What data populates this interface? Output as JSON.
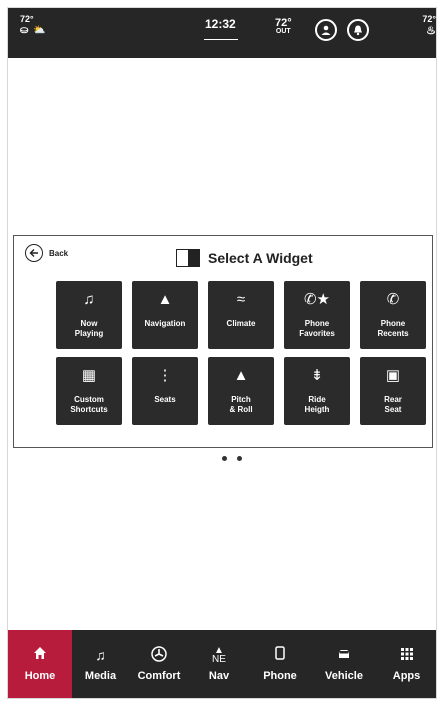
{
  "status_bar": {
    "left_temp": "72°",
    "left_icons": "⛀ ⛅",
    "time": "12:32",
    "outside_temp": "72°",
    "outside_label": "OUT",
    "right_temp": "72°",
    "right_icon": "♨"
  },
  "panel": {
    "back_label": "Back",
    "title": "Select A Widget"
  },
  "widgets": [
    {
      "label1": "Now",
      "label2": "Playing",
      "icon": "♫",
      "icon_name": "music-note-icon"
    },
    {
      "label1": "Navigation",
      "label2": "",
      "icon": "▲",
      "icon_name": "navigation-arrow-icon"
    },
    {
      "label1": "Climate",
      "label2": "",
      "icon": "≈",
      "icon_name": "climate-fan-icon"
    },
    {
      "label1": "Phone",
      "label2": "Favorites",
      "icon": "✆★",
      "icon_name": "phone-favorites-icon"
    },
    {
      "label1": "Phone",
      "label2": "Recents",
      "icon": "✆",
      "icon_name": "phone-recents-icon"
    },
    {
      "label1": "Custom",
      "label2": "Shortcuts",
      "icon": "▦",
      "icon_name": "grid-shortcuts-icon"
    },
    {
      "label1": "Seats",
      "label2": "",
      "icon": "⋮",
      "icon_name": "heated-seat-icon"
    },
    {
      "label1": "Pitch",
      "label2": "& Roll",
      "icon": "▲",
      "icon_name": "mountain-icon"
    },
    {
      "label1": "Ride",
      "label2": "Heigth",
      "icon": "⇟",
      "icon_name": "ride-height-icon"
    },
    {
      "label1": "Rear",
      "label2": "Seat",
      "icon": "▣",
      "icon_name": "rear-seat-icon"
    }
  ],
  "page_dots": 2,
  "nav": {
    "home": "Home",
    "media": "Media",
    "comfort": "Comfort",
    "nav": "Nav",
    "nav_compass": "NE",
    "phone": "Phone",
    "vehicle": "Vehicle",
    "apps": "Apps"
  },
  "colors": {
    "bar_bg": "#262626",
    "active_tab": "#b71c3c",
    "tile_bg": "#2b2b2b"
  }
}
